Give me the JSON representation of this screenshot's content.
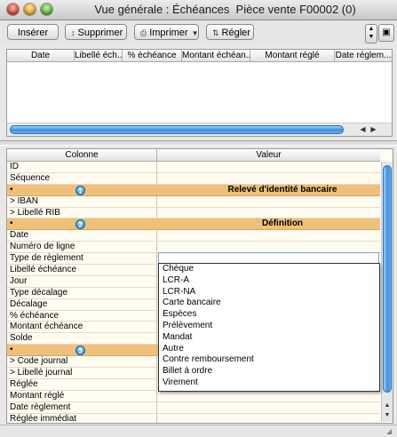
{
  "window": {
    "title": "Vue générale : Échéances  Pièce vente F00002 (0)"
  },
  "toolbar": {
    "inserer": "Insérer",
    "supprimer": "Supprimer",
    "imprimer": "Imprimer",
    "regler": "Régler",
    "supprimer_icon": "plus-minus-icon",
    "imprimer_icon": "printer-icon",
    "regler_icon": "up-down-arrows-icon"
  },
  "top_grid": {
    "columns": [
      "Date",
      "Libellé éch...",
      "% échéance",
      "Montant échéan...",
      "Montant réglé",
      "Date réglem..."
    ]
  },
  "property_grid": {
    "header_col1": "Colonne",
    "header_col2": "Valeur",
    "rows": [
      {
        "label": "ID"
      },
      {
        "label": "Séquence"
      },
      {
        "label": "•",
        "section": true,
        "badge": "1",
        "title": "Relevé d'identité bancaire"
      },
      {
        "label": "> IBAN"
      },
      {
        "label": "> Libellé RIB"
      },
      {
        "label": "•",
        "section": true,
        "badge": "2",
        "title": "Définition"
      },
      {
        "label": "Date"
      },
      {
        "label": "Numéro de ligne"
      },
      {
        "label": "Type de règlement",
        "editing": true
      },
      {
        "label": "Libellé échéance"
      },
      {
        "label": "Jour"
      },
      {
        "label": "Type décalage"
      },
      {
        "label": "Décalage"
      },
      {
        "label": "% échéance"
      },
      {
        "label": "Montant échéance"
      },
      {
        "label": "Solde"
      },
      {
        "label": "•",
        "section": true,
        "badge": "3",
        "title": ""
      },
      {
        "label": "> Code journal"
      },
      {
        "label": "> Libellé journal"
      },
      {
        "label": "Réglée"
      },
      {
        "label": "Montant réglé"
      },
      {
        "label": "Date règlement"
      },
      {
        "label": "Réglée immédiat"
      }
    ]
  },
  "dropdown": {
    "options": [
      "Chèque",
      "LCR-A",
      "LCR-NA",
      "Carte bancaire",
      "Espèces",
      "Prélèvement",
      "Mandat",
      "Autre",
      "Contre remboursement",
      "Billet à ordre",
      "Virement"
    ]
  },
  "colors": {
    "section_band": "#efc07a",
    "grid_background": "#fffbf1",
    "scroll_thumb": "#3d8fe0"
  }
}
